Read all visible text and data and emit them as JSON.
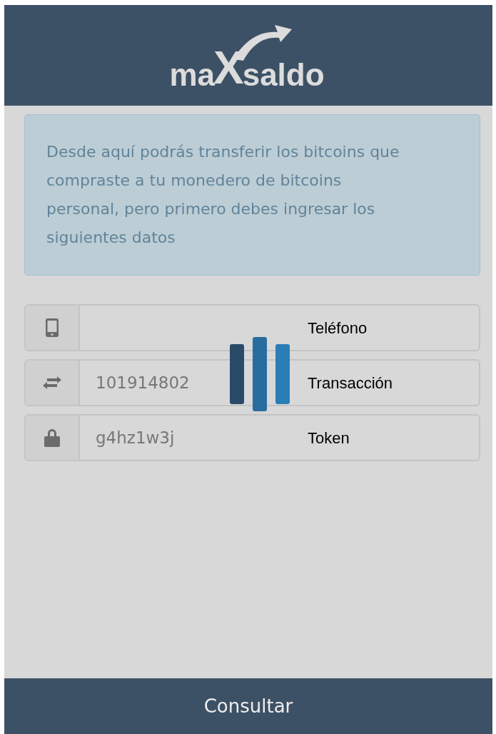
{
  "logo": {
    "parts": [
      "ma",
      "X",
      "saldo"
    ]
  },
  "notice": "Desde aquí podrás transferir los bitcoins que compraste a tu monedero de bitcoins personal, pero primero debes ingresar los siguientes datos",
  "fields": [
    {
      "kind": "phone",
      "label": "Teléfono"
    },
    {
      "kind": "transfer",
      "value": "101914802",
      "label": "Transacción"
    },
    {
      "kind": "lock",
      "value": "g4hz1w3j",
      "label": "Token"
    }
  ],
  "loading": true,
  "submit": "Consultar"
}
